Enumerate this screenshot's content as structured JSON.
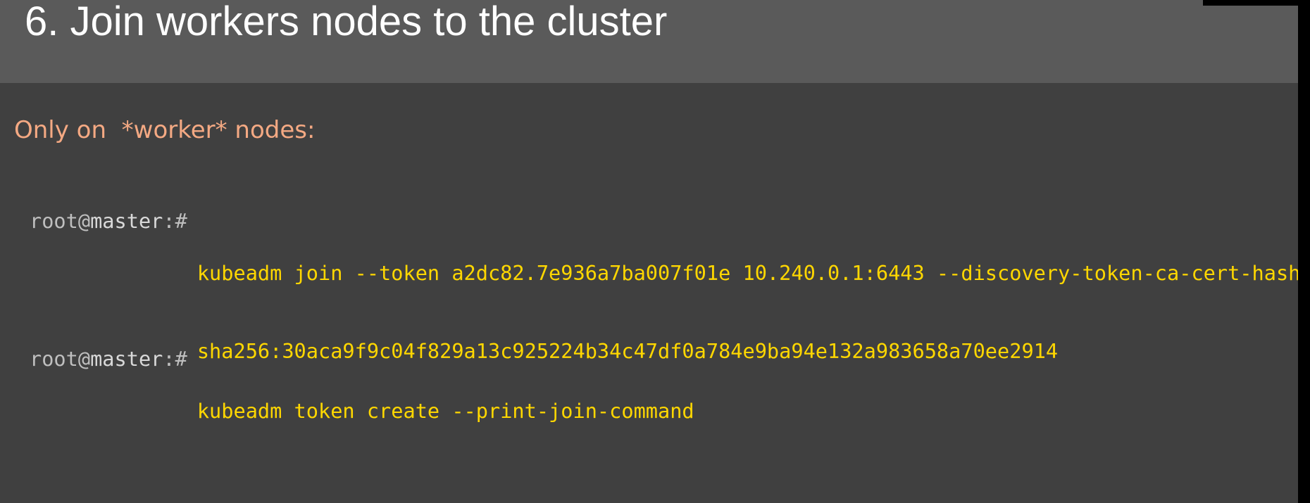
{
  "slide": {
    "title": "6. Join workers nodes to the cluster",
    "subheading": "Only on  *worker* nodes:"
  },
  "prompt": {
    "user": "root",
    "at": "@",
    "host": "master",
    "suffix": ":#"
  },
  "commands": [
    {
      "lines": [
        "kubeadm join --token a2dc82.7e936a7ba007f01e 10.240.0.1:6443 --discovery-token-ca-cert-hash",
        "sha256:30aca9f9c04f829a13c925224b34c47df0a784e9ba94e132a983658a70ee2914"
      ]
    },
    {
      "lines": [
        "kubeadm token create --print-join-command"
      ]
    }
  ],
  "colors": {
    "slide_background": "#404040",
    "title_band": "#5a5a5a",
    "title_text": "#ffffff",
    "subheading_text": "#f4a983",
    "command_text": "#ffd700",
    "prompt_text": "#bfbfbf"
  }
}
